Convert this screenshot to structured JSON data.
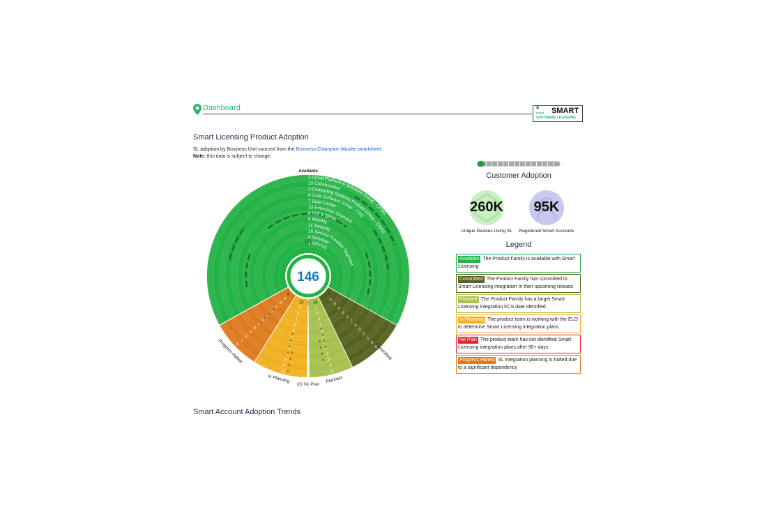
{
  "header": {
    "nav_title": "Dashboard",
    "logo_brand": "cisco",
    "logo_title": "SMART",
    "logo_subtitle": "SOFTWARE LICENSING"
  },
  "main": {
    "section_title": "Smart Licensing Product Adoption",
    "description_prefix": "SL adoption by Business Unit sourced from the ",
    "description_link": "Business Champion Master smartsheet",
    "description_suffix": ".",
    "note_label": "Note:",
    "note_text": " this data is subject to change.",
    "section2_title": "Smart Account Adoption Trends"
  },
  "chart_data": {
    "type": "radial-sunburst",
    "center_total": "146",
    "rings": [
      "Cloud Platform & Solutions Group - CPSG",
      "Collaboration",
      "Computing Systems Product Group - CSPG",
      "Core Software Group - CSG",
      "Data Center",
      "Enterprise Segment",
      "IOT & Other",
      "Mobility",
      "Security",
      "Service Provider Segment",
      "Services",
      "SPVSS"
    ],
    "sectors": [
      {
        "name": "Available",
        "total": "101",
        "color": "#24b246",
        "values": [
          "3",
          "10",
          "3",
          "8",
          "7",
          "33",
          "4",
          "5",
          "11",
          "16",
          "0",
          "1"
        ]
      },
      {
        "name": "Committed",
        "total": "4",
        "color": "#55611e",
        "values": [
          "0",
          "0",
          "1",
          "0",
          "0",
          "0",
          "1",
          "0",
          "2",
          "0",
          "0",
          "0"
        ]
      },
      {
        "name": "Planned",
        "total": "18",
        "color": "#a6c04d",
        "values": [
          "0",
          "4",
          "2",
          "0",
          "1",
          "0",
          "1",
          "0",
          "1",
          "6",
          "0",
          "1"
        ]
      },
      {
        "name": "No Plan",
        "total": "0",
        "label": "(0) No Plan",
        "color": "#e8232e",
        "values": []
      },
      {
        "name": "In Planning",
        "total": "19",
        "color": "#f0b020",
        "values": [
          "0",
          "0",
          "0",
          "1",
          "0",
          "4",
          "2",
          "0",
          "4",
          "1",
          "0",
          "0"
        ]
      },
      {
        "name": "Progress Halted",
        "total": "4",
        "color": "#dd7a1e",
        "values": [
          "0",
          "1",
          "0",
          "0",
          "0",
          "0",
          "0",
          "1",
          "1",
          "0",
          "0",
          "0"
        ]
      }
    ]
  },
  "right_panel": {
    "title": "Customer Adoption",
    "stats": [
      {
        "value": "260K",
        "label": "Unique Devices Using SL",
        "color": "#c9f0c4"
      },
      {
        "value": "95K",
        "label": "Registered Smart Accounts",
        "color": "#c9c8f0"
      }
    ],
    "legend_title": "Legend",
    "legend": [
      {
        "badge": "Available",
        "text": "The Product Family is available with Smart Licensing",
        "color": "#24b246"
      },
      {
        "badge": "Committed",
        "text": "The Product Family has committed to Smart Licensing integration in their upcoming release",
        "color": "#55611e"
      },
      {
        "badge": "Planned",
        "text": "The Product Family has a target Smart Licensing integration FCS date identified",
        "color": "#a6c04d"
      },
      {
        "badge": "In Planning",
        "text": "The product team is working with the ELO to determine Smart Licensing integration plans",
        "color": "#f0b020"
      },
      {
        "badge": "No Plan",
        "text": "The product team has not identified Smart Licensing integration plans after 90+ days",
        "color": "#e8232e"
      },
      {
        "badge": "Progress Halted",
        "text": "SL integration planning is halted due to a significant dependency",
        "color": "#dd7a1e"
      }
    ],
    "slider_position": 0.0
  }
}
